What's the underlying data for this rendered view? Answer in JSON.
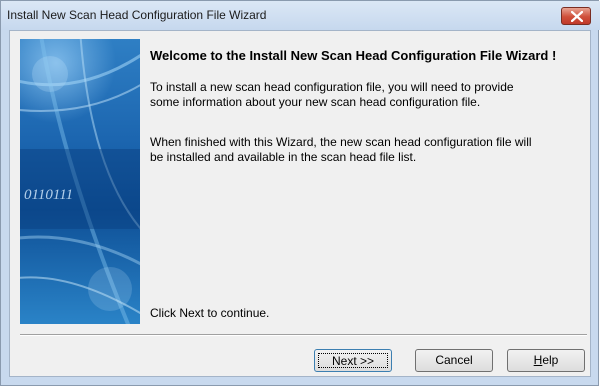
{
  "window": {
    "title": "Install New Scan Head Configuration File Wizard"
  },
  "content": {
    "heading": "Welcome to the Install New Scan Head Configuration File Wizard !",
    "para1_line1": "To install a new scan head configuration file, you will need to provide",
    "para1_line2": "some information about your new scan head configuration file.",
    "para2_line1": "When finished with this Wizard, the new scan head configuration file will",
    "para2_line2": "be installed and available in the scan head file list.",
    "continue_text": "Click Next to continue."
  },
  "banner": {
    "binary_text": "0110111"
  },
  "buttons": {
    "next_label": "Next >>",
    "cancel_label": "Cancel",
    "help_mnemonic": "H",
    "help_rest": "elp"
  },
  "colors": {
    "banner_dark": "#0b4f93",
    "banner_light": "#3a8fd0",
    "close_red": "#c0392b"
  }
}
